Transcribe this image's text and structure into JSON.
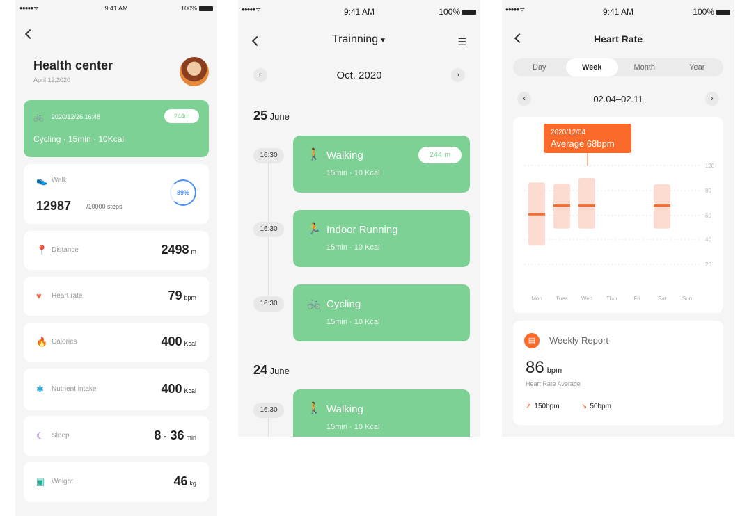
{
  "status": {
    "signal": "●●●●● ᯤ",
    "time": "9:41 AM",
    "battery": "100%"
  },
  "health": {
    "title": "Health center",
    "date": "April 12,2020",
    "banner": {
      "timestamp": "2020/12/26 16:48",
      "distance": "244m",
      "summary": "Cycling · 15min · 10Kcal"
    },
    "walk": {
      "label": "Walk",
      "steps": "12987",
      "goal": "/10000 steps",
      "percent": "89%"
    },
    "distance": {
      "label": "Distance",
      "value": "2498",
      "unit": "m"
    },
    "heart_rate": {
      "label": "Heart rate",
      "value": "79",
      "unit": "bpm"
    },
    "calories": {
      "label": "Calories",
      "value": "400",
      "unit": "Kcal"
    },
    "nutrient": {
      "label": "Nutrient intake",
      "value": "400",
      "unit": "Kcal"
    },
    "sleep": {
      "label": "Sleep",
      "hours": "8",
      "h_unit": "h",
      "minutes": "36",
      "m_unit": "min"
    },
    "weight": {
      "label": "Weight",
      "value": "46",
      "unit": "kg"
    }
  },
  "training": {
    "title": "Trainning",
    "month": "Oct. 2020",
    "days": [
      {
        "day": "25",
        "month": "June"
      },
      {
        "day": "24",
        "month": "June"
      }
    ],
    "activities": [
      {
        "time": "16:30",
        "icon": "walking-icon",
        "name": "Walking",
        "info": "15min · 10 Kcal",
        "badge": "244 m"
      },
      {
        "time": "16:30",
        "icon": "running-icon",
        "name": "Indoor Running",
        "info": "15min · 10 Kcal"
      },
      {
        "time": "16:30",
        "icon": "cycling-icon",
        "name": "Cycling",
        "info": "15min · 10 Kcal"
      },
      {
        "time": "16:30",
        "icon": "walking-icon",
        "name": "Walking",
        "info": "15min · 10 Kcal"
      }
    ]
  },
  "heart": {
    "title": "Heart Rate",
    "tabs": [
      "Day",
      "Week",
      "Month",
      "Year"
    ],
    "active_tab": "Week",
    "range": "02.04–02.11",
    "tooltip": {
      "date": "2020/12/04",
      "text": "Average 68bpm"
    },
    "report": {
      "title": "Weekly Report",
      "value": "86",
      "unit": "bpm",
      "label": "Heart Rate Average",
      "high": "150bpm",
      "low": "50bpm"
    }
  },
  "colors": {
    "green": "#7dd195",
    "orange": "#fa6b2b",
    "blue": "#4a8ff7"
  },
  "chart_data": {
    "type": "bar",
    "categories": [
      "Mon",
      "Tues",
      "Wed",
      "Thur",
      "Fri",
      "Sat",
      "Sun"
    ],
    "yticks": [
      120,
      80,
      60,
      40,
      20
    ],
    "series": [
      {
        "low": [
          35,
          49,
          49,
          null,
          null,
          49,
          null
        ],
        "high": [
          93,
          91,
          100,
          null,
          null,
          90,
          null
        ],
        "average": [
          61,
          68,
          68,
          null,
          null,
          68,
          null
        ]
      }
    ],
    "ylim": [
      0,
      120
    ],
    "grid": true
  }
}
